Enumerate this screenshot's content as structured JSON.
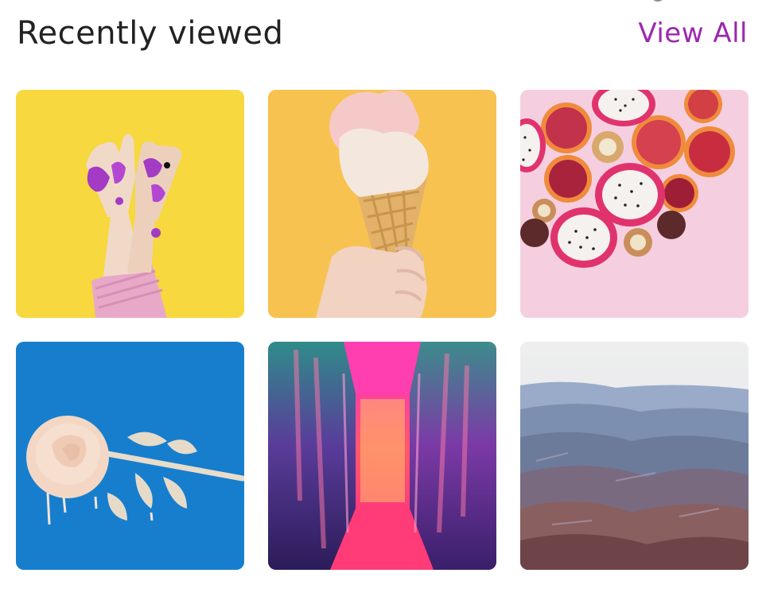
{
  "section": {
    "title": "Recently viewed",
    "view_all_label": "View All"
  },
  "items": [
    {
      "subject": "painted-hands",
      "color": "#f6d63a"
    },
    {
      "subject": "ice-cream-cone",
      "color": "#f7bf49"
    },
    {
      "subject": "dragon-fruit-and-blood-oranges",
      "color": "#f5cfe0"
    },
    {
      "subject": "white-rose",
      "color": "#1478c8"
    },
    {
      "subject": "neon-hallway",
      "color": "#e83a7c"
    },
    {
      "subject": "mountain-landscape",
      "color": "#6f7f9c"
    }
  ],
  "colors": {
    "accent": "#9c27b0",
    "title": "#222222"
  }
}
